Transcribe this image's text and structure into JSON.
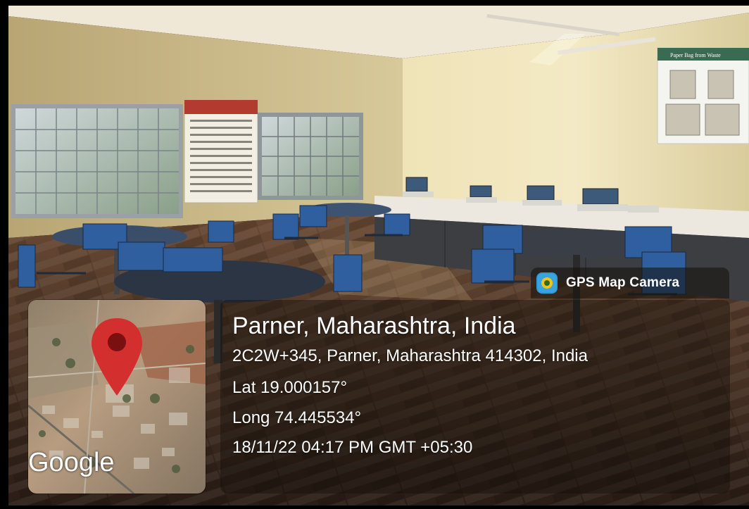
{
  "badge": {
    "label": "GPS Map Camera",
    "icon": "gps-map-camera-app-icon"
  },
  "location": {
    "title": "Parner, Maharashtra, India",
    "address": "2C2W+345, Parner, Maharashtra 414302, India",
    "latitude": "Lat 19.000157°",
    "longitude": "Long 74.445534°",
    "timestamp": "18/11/22 04:17 PM GMT +05:30"
  },
  "map": {
    "attribution": "Google",
    "marker_icon": "map-pin-icon",
    "marker_color": "#d32f2f"
  },
  "poster": {
    "title": "Paper Bag from Waste"
  }
}
